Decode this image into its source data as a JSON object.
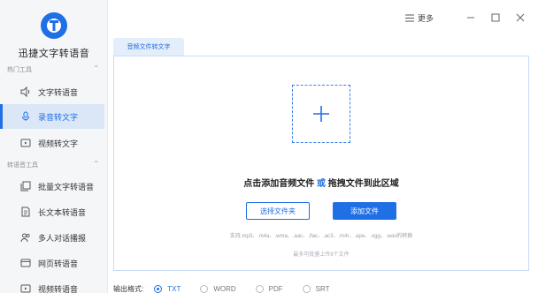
{
  "app": {
    "title": "迅捷文字转语音",
    "brand_color": "#1f6fe5"
  },
  "titlebar": {
    "more_label": "更多",
    "menu_icon": "hamburger-icon",
    "minimize_icon": "minimize-icon",
    "maximize_icon": "maximize-icon",
    "close_icon": "close-icon"
  },
  "sidebar": {
    "section_hot": "热门工具",
    "section_convert": "转语音工具",
    "items": [
      {
        "label": "文字转语音",
        "icon": "speaker-icon"
      },
      {
        "label": "录音转文字",
        "icon": "mic-icon",
        "active": true
      },
      {
        "label": "视频转文字",
        "icon": "video-icon"
      },
      {
        "label": "批量文字转语音",
        "icon": "batch-icon"
      },
      {
        "label": "长文本转语音",
        "icon": "document-icon"
      },
      {
        "label": "多人对话播报",
        "icon": "people-icon"
      },
      {
        "label": "网页转语音",
        "icon": "web-icon"
      },
      {
        "label": "视频转语音",
        "icon": "video-icon"
      }
    ]
  },
  "main": {
    "tab_label": "音频文件转文字",
    "drop_prompt_a": "点击添加音频文件",
    "drop_prompt_or": "或",
    "drop_prompt_b": "拖拽文件到此区域",
    "select_folder_label": "选择文件夹",
    "add_file_label": "添加文件",
    "supported_formats": "支持.mp3、.m4a、.wma、.aac、.flac、.ac3、.m4r、.ape、.ogg、.wav的转换",
    "upload_limit": "最多可批量上传8个文件"
  },
  "output": {
    "label": "输出格式:",
    "options": [
      "TXT",
      "WORD",
      "PDF",
      "SRT"
    ],
    "selected": "TXT"
  }
}
